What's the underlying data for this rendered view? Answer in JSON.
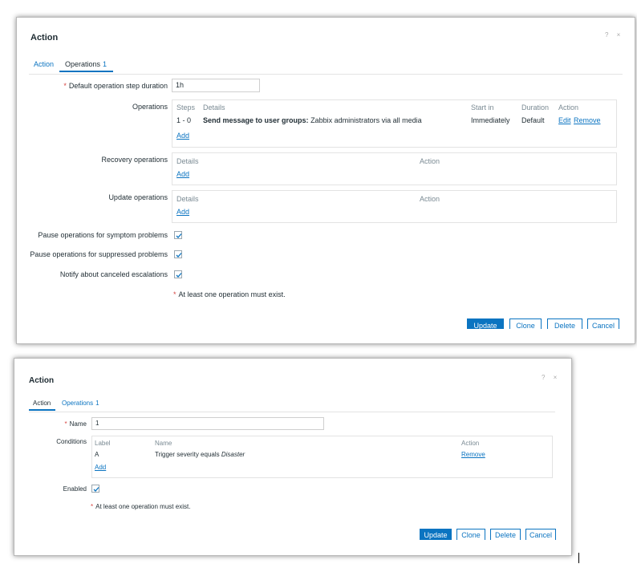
{
  "top": {
    "title": "Action",
    "tabs": [
      {
        "label": "Action",
        "count": ""
      },
      {
        "label": "Operations",
        "count": "1"
      }
    ],
    "step_duration": {
      "label": "Default operation step duration",
      "value": "1h"
    },
    "operations": {
      "label": "Operations",
      "headers": [
        "Steps",
        "Details",
        "Start in",
        "Duration",
        "Action"
      ],
      "row": {
        "steps": "1 - 0",
        "details_bold": "Send message to user groups:",
        "details_rest": "Zabbix administrators via all media",
        "start_in": "Immediately",
        "duration": "Default",
        "edit": "Edit",
        "remove": "Remove"
      },
      "add": "Add"
    },
    "recovery": {
      "label": "Recovery operations",
      "headers": [
        "Details",
        "Action"
      ],
      "add": "Add"
    },
    "update": {
      "label": "Update operations",
      "headers": [
        "Details",
        "Action"
      ],
      "add": "Add"
    },
    "checkboxes": [
      {
        "label": "Pause operations for symptom problems",
        "checked": true
      },
      {
        "label": "Pause operations for suppressed problems",
        "checked": true
      },
      {
        "label": "Notify about canceled escalations",
        "checked": true
      }
    ],
    "note": "At least one operation must exist.",
    "buttons": {
      "update": "Update",
      "clone": "Clone",
      "delete": "Delete",
      "cancel": "Cancel"
    }
  },
  "bottom": {
    "title": "Action",
    "tabs": [
      {
        "label": "Action",
        "count": ""
      },
      {
        "label": "Operations",
        "count": "1"
      }
    ],
    "name": {
      "label": "Name",
      "value": "1"
    },
    "conditions": {
      "label": "Conditions",
      "headers": [
        "Label",
        "Name",
        "Action"
      ],
      "row": {
        "label": "A",
        "name_prefix": "Trigger severity equals",
        "name_value": "Disaster",
        "remove": "Remove"
      },
      "add": "Add"
    },
    "enabled": {
      "label": "Enabled",
      "checked": true
    },
    "note": "At least one operation must exist.",
    "buttons": {
      "update": "Update",
      "clone": "Clone",
      "delete": "Delete",
      "cancel": "Cancel"
    }
  },
  "colors": {
    "accent": "#0b74c1",
    "required": "#d64541"
  }
}
